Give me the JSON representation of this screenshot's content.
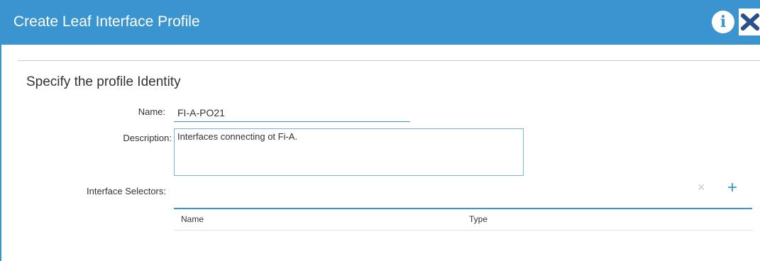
{
  "dialog": {
    "title": "Create Leaf Interface Profile",
    "header_icons": [
      "info-icon",
      "close-icon"
    ],
    "colors": {
      "header": "#3a94cf",
      "accent": "#3a94cf",
      "close_x": "#2a4f8a"
    }
  },
  "form": {
    "section_title": "Specify the profile Identity",
    "name_label": "Name:",
    "name_value": "FI-A-PO21",
    "description_label": "Description:",
    "description_value": "Interfaces connecting ot Fi-A.",
    "selectors_label": "Interface Selectors:"
  },
  "table": {
    "delete_symbol": "×",
    "add_symbol": "+",
    "columns": [
      "Name",
      "Type"
    ],
    "rows": []
  }
}
